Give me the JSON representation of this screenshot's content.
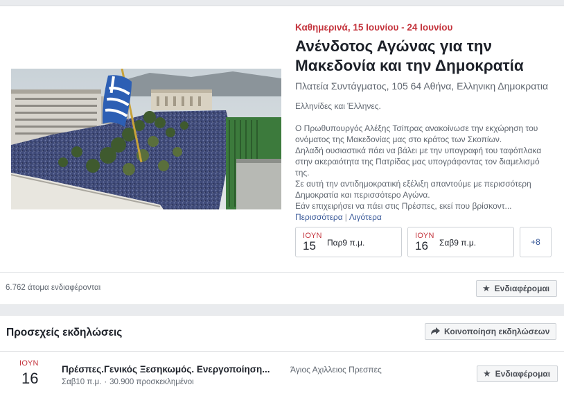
{
  "event": {
    "date_line": "Καθημερινά, 15 Ιουνίου - 24 Ιουνίου",
    "title_line1": "Ανένδοτος Αγώνας για την",
    "title_line2": "Μακεδονία και την Δημοκρατία",
    "location": "Πλατεία Συντάγματος, 105 64 Αθήνα, Ελληνικη Δημοκρατια",
    "description": {
      "greeting": "Ελληνίδες και Έλληνες.",
      "line1": "Ο Πρωθυπουργός Αλέξης Τσίπρας ανακοίνωσε την εκχώρηση του",
      "line2": "ονόματος της Μακεδονίας μας στο κράτος των Σκοπίων.",
      "line3": "Δηλαδή ουσιαστικά πάει να βάλει με την υπογραφή του ταφόπλακα",
      "line4": "στην ακεραιότητα της Πατρίδας μας υπογράφοντας τον διαμελισμό",
      "line5": "της.",
      "line6": "Σε αυτή την αντιδημοκρατική εξέλιξη απαντούμε με περισσότερη",
      "line7": "Δημοκρατία και περισσότερο Αγώνα.",
      "line8": "Εάν επιχειρήσει να πάει στις Πρέσπες, εκεί που βρίσκοντ..."
    },
    "more_link": "Περισσότερα",
    "less_link": "Λιγότερα",
    "link_separator": "|",
    "dates": [
      {
        "month": "ΙΟΥΝ",
        "day": "15",
        "time": "Παρ9 π.μ."
      },
      {
        "month": "ΙΟΥΝ",
        "day": "16",
        "time": "Σαβ9 π.μ."
      }
    ],
    "more_dates": "+8",
    "interested_count": "6.762 άτομα ενδιαφέρονται",
    "interested_button": "Ενδιαφέρομαι"
  },
  "upcoming": {
    "section_title": "Προσεχείς εκδηλώσεις",
    "share_button": "Κοινοποίηση εκδηλώσεων",
    "item": {
      "month": "ΙΟΥΝ",
      "day": "16",
      "title": "Πρέσπες.Γενικός Ξεσηκωμός. Ενεργοποίηση...",
      "time": "Σαβ10 π.μ.",
      "dot": "·",
      "guests": "30.900 προσκεκλημένοι",
      "place": "Άγιος Αχιλλειος Πρεσπες",
      "interested_button": "Ενδιαφέρομαι"
    }
  },
  "icons": {
    "star": "star-icon",
    "share": "share-arrow-icon"
  },
  "colors": {
    "accent_red": "#c4343d",
    "link_blue": "#385898",
    "flag_blue": "#2d5fb4"
  }
}
